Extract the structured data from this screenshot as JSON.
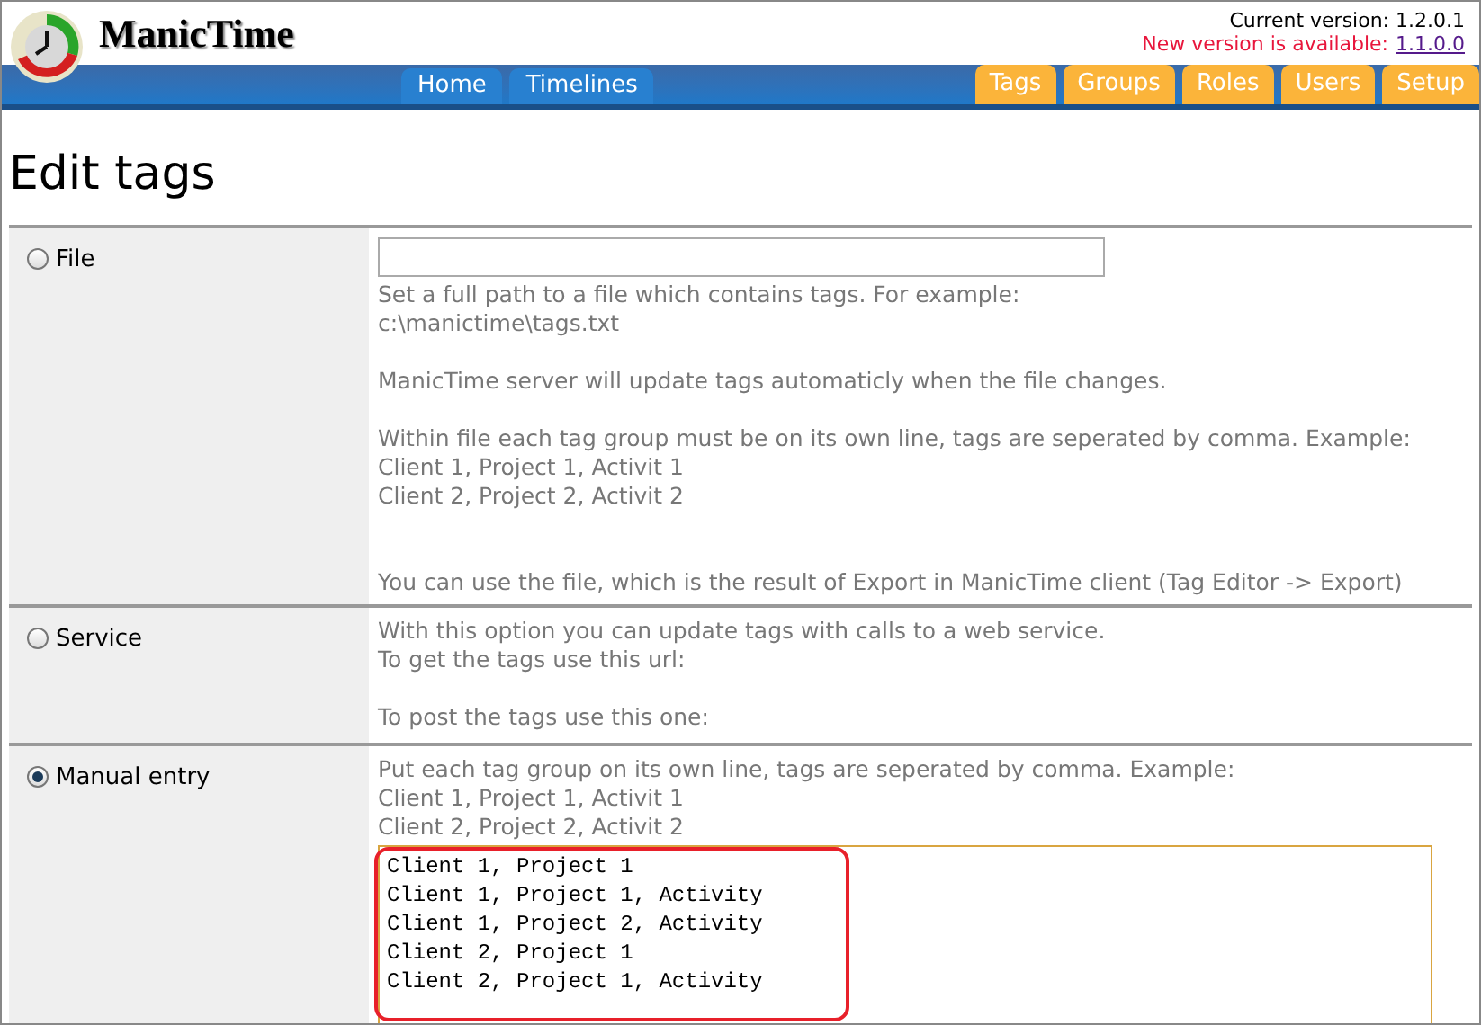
{
  "header": {
    "brand": "ManicTime",
    "current_version": "Current version: 1.2.0.1",
    "new_version_label": "New version is available:",
    "new_version_link": "1.1.0.0"
  },
  "nav": {
    "left": [
      "Home",
      "Timelines"
    ],
    "right": [
      "Tags",
      "Groups",
      "Roles",
      "Users",
      "Setup"
    ]
  },
  "title": "Edit tags",
  "options": [
    {
      "label": "File",
      "selected": false,
      "kind": "file",
      "paragraphs": [
        [
          "Set a full path to a file which contains tags. For example:",
          "c:\\manictime\\tags.txt"
        ],
        [
          "ManicTime server will update tags automaticly when the file changes."
        ],
        [
          "Within file each tag group must be on its own line, tags are seperated by comma. Example:",
          "Client 1, Project 1, Activit 1",
          "Client 2, Project 2, Activit 2"
        ],
        [
          "You can use the file, which is the result of Export in ManicTime client (Tag Editor -> Export)"
        ]
      ]
    },
    {
      "label": "Service",
      "selected": false,
      "kind": "service",
      "paragraphs": [
        [
          "With this option you can update tags with calls to a web service.",
          "To get the tags use this url:"
        ],
        [
          "To post the tags use this one:"
        ]
      ]
    },
    {
      "label": "Manual entry",
      "selected": true,
      "kind": "manual",
      "paragraphs": [
        [
          "Put each tag group on its own line, tags are seperated by comma. Example:",
          "Client 1, Project 1, Activit 1",
          "Client 2, Project 2, Activit 2"
        ]
      ],
      "value": "Client 1, Project 1\nClient 1, Project 1, Activity\nClient 1, Project 2, Activity\nClient 2, Project 1\nClient 2, Project 1, Activity"
    }
  ]
}
